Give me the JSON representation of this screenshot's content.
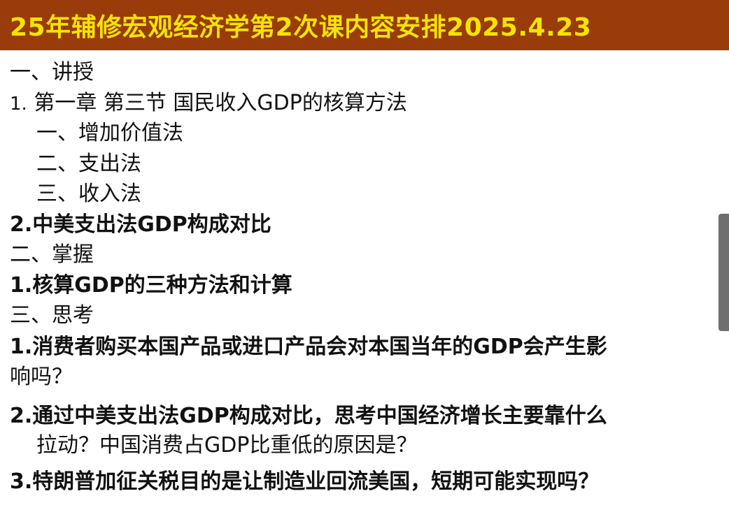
{
  "title": "25年辅修宏观经济学第2次课内容安排2025.4.23",
  "section1": {
    "heading": "一、讲授",
    "item1": {
      "number": "1.",
      "text": "第一章  第三节 国民收入GDP的核算方法",
      "sub": [
        "一、增加价值法",
        "二、支出法",
        "三、收入法"
      ]
    },
    "item2": "2.中美支出法GDP构成对比"
  },
  "section2": {
    "heading": "二、掌握",
    "item1": "1.核算GDP的三种方法和计算"
  },
  "section3": {
    "heading": "三、思考",
    "q1_line1": "1.消费者购买本国产品或进口产品会对本国当年的GDP会产生影",
    "q1_line2": "响吗？",
    "q2_line1": "2.通过中美支出法GDP构成对比，思考中国经济增长主要靠什么",
    "q2_line2": "拉动？中国消费占GDP比重低的原因是？",
    "q3": "3.特朗普加征关税目的是让制造业回流美国，短期可能实现吗？"
  }
}
